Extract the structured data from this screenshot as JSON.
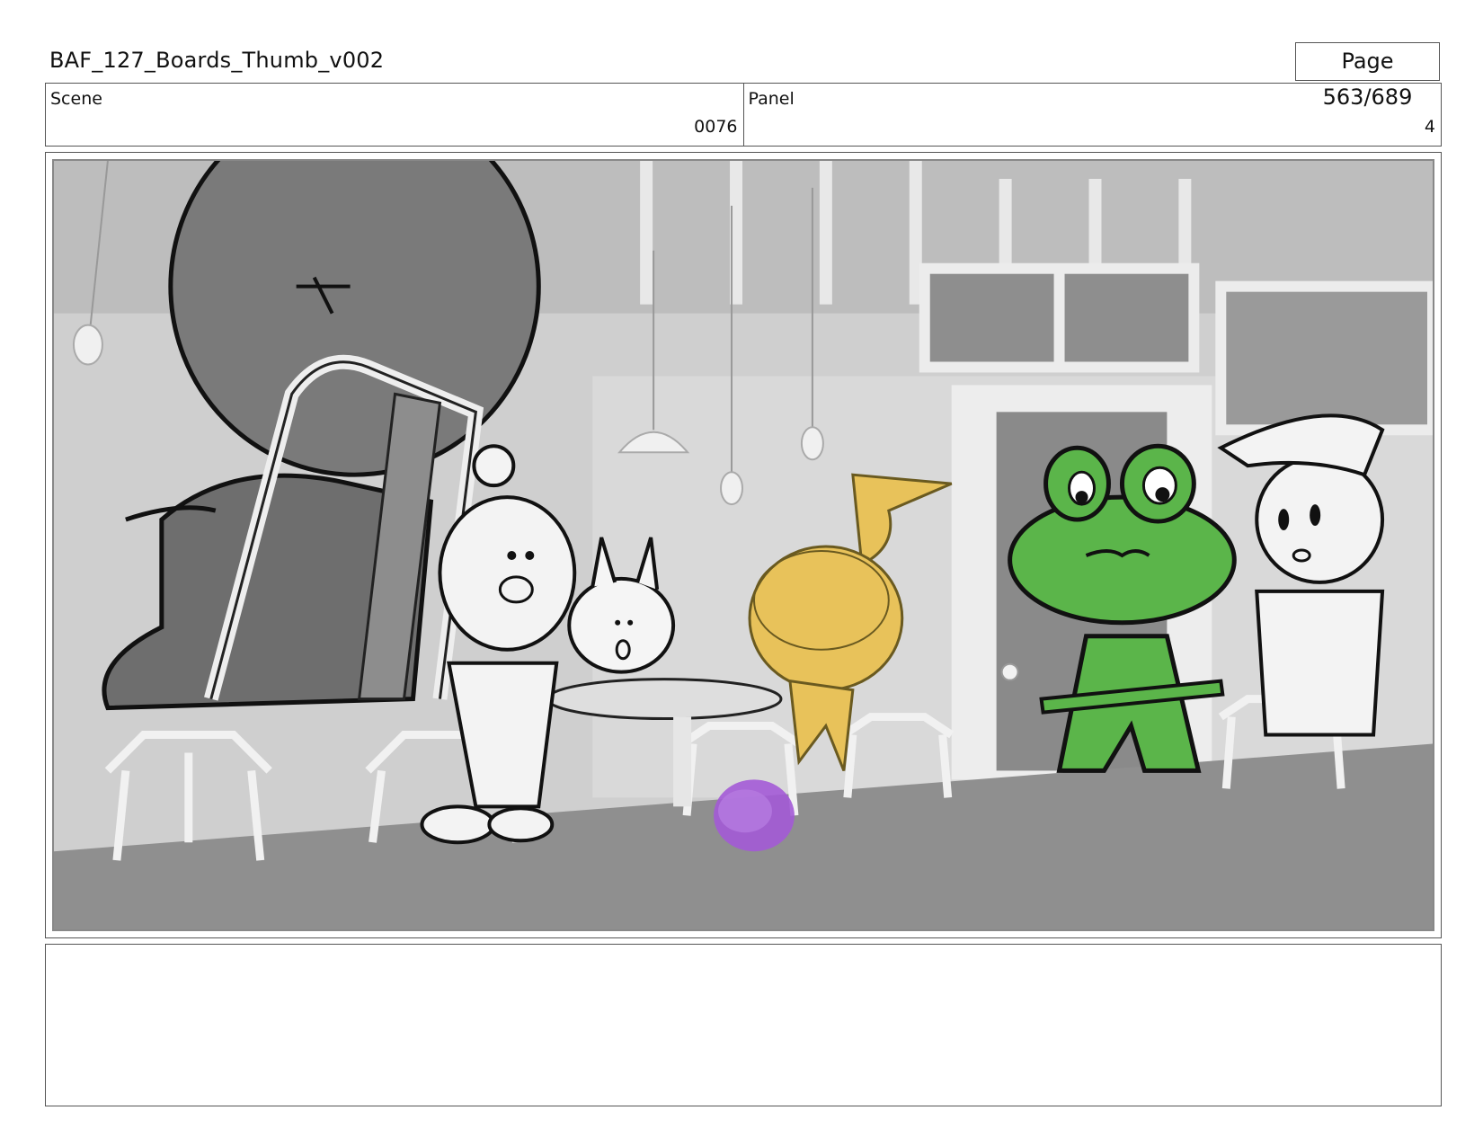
{
  "document": {
    "title": "BAF_127_Boards_Thumb_v002",
    "page": "Page 563/689"
  },
  "header": {
    "scene_label": "Scene",
    "scene_value": "0076",
    "panel_label": "Panel",
    "panel_value": "4"
  },
  "panel_image": {
    "colors": {
      "background": "#cfcfcf",
      "floor": "#8f8f8f",
      "frog_green": "#5bb54a",
      "chick_yellow": "#e8c25a",
      "ball_purple": "#a35ad6"
    }
  },
  "notes": {
    "text": ""
  }
}
